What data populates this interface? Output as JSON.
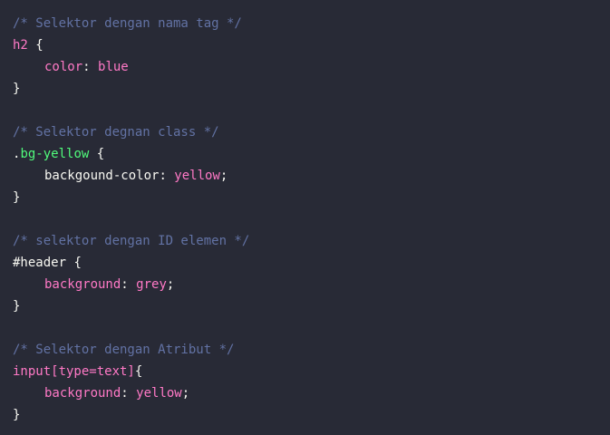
{
  "theme": {
    "background": "#282a36",
    "comment": "#6272a4",
    "selector_tag": "#ff79c6",
    "selector_class": "#50fa7b",
    "text": "#f8f8f2",
    "property": "#ff79c6",
    "value": "#ff79c6"
  },
  "blocks": [
    {
      "comment": "/* Selektor dengan nama tag */",
      "selector": "h2",
      "open": " {",
      "declarations": [
        {
          "property": "color",
          "colon": ": ",
          "value": "blue",
          "semi": ""
        }
      ],
      "close": "}"
    },
    {
      "comment": "/* Selektor degnan class */",
      "selector_prefix": ".",
      "selector": "bg-yellow",
      "open": " {",
      "declarations": [
        {
          "property": "backgound-color",
          "colon": ": ",
          "value": "yellow",
          "semi": ";"
        }
      ],
      "close": "}"
    },
    {
      "comment": "/* selektor dengan ID elemen */",
      "selector": "#header",
      "open": " {",
      "declarations": [
        {
          "property": "background",
          "colon": ": ",
          "value": "grey",
          "semi": ";"
        }
      ],
      "close": "}"
    },
    {
      "comment": "/* Selektor dengan Atribut */",
      "selector": "input[type=text]",
      "open": "{",
      "declarations": [
        {
          "property": "background",
          "colon": ": ",
          "value": "yellow",
          "semi": ";"
        }
      ],
      "close": "}"
    }
  ]
}
